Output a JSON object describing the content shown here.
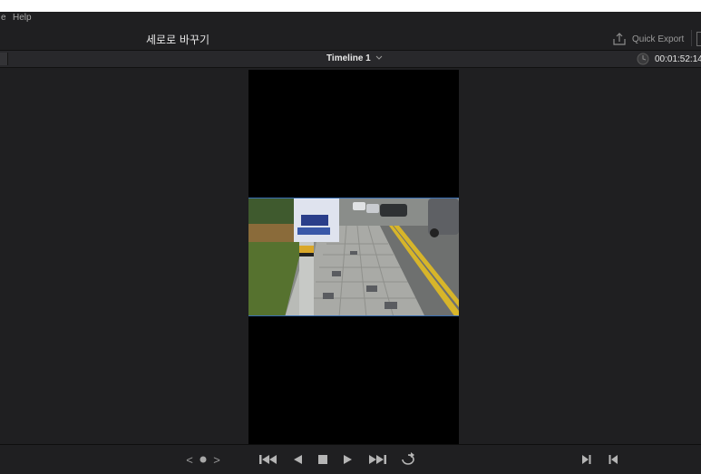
{
  "menubar": {
    "items": [
      "e",
      "Help"
    ]
  },
  "titlebar": {
    "project_title": "세로로 바꾸기",
    "quick_export_label": "Quick Export"
  },
  "viewer": {
    "timeline_name": "Timeline 1",
    "timecode": "00:01:52:14"
  },
  "transport": {
    "prev_label": "<",
    "next_label": ">"
  },
  "colors": {
    "background": "#1f1f21",
    "accent_border": "#3a6fb3",
    "text": "#c9c9c9"
  },
  "icons": {
    "quick_export": "upload-icon",
    "timeline_dropdown": "chevron-down-icon",
    "clock": "clock-icon",
    "dot": "dot-icon",
    "first_frame": "skip-back-icon",
    "reverse": "play-reverse-icon",
    "stop": "stop-icon",
    "play": "play-icon",
    "last_frame": "skip-forward-icon",
    "loop": "loop-icon",
    "mark_in": "mark-in-icon",
    "mark_out": "mark-out-icon"
  }
}
